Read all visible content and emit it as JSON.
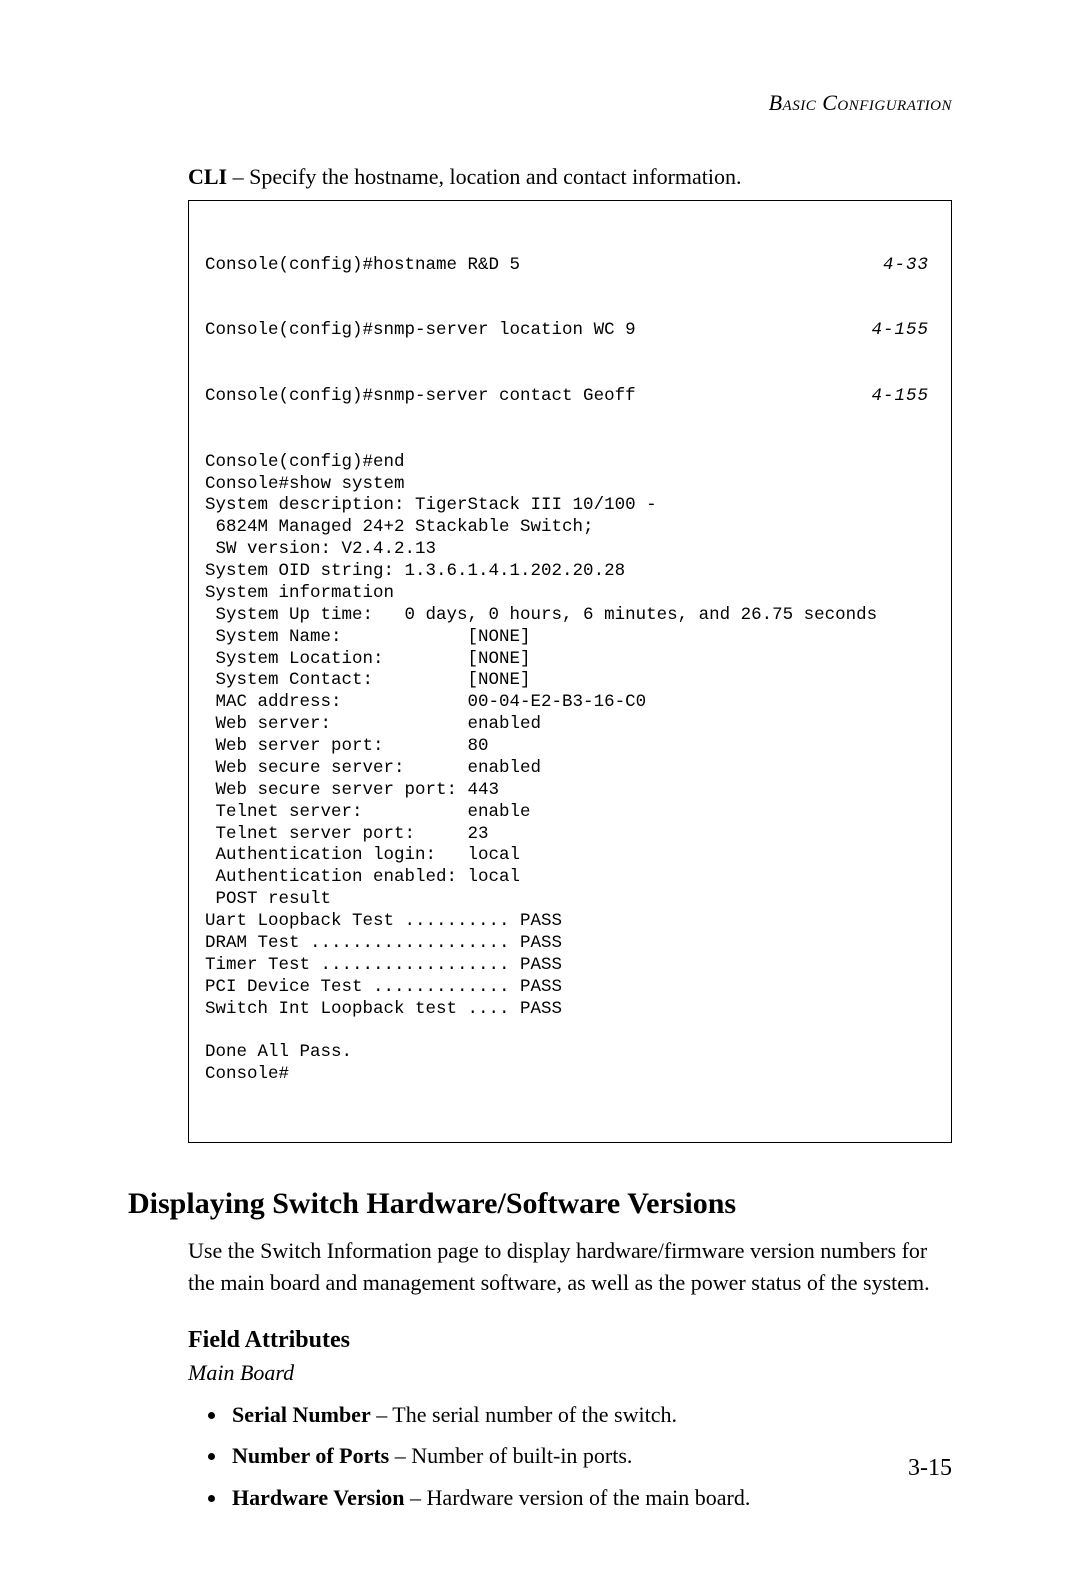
{
  "runningHead": "Basic Configuration",
  "intro": {
    "lead": "CLI",
    "rest": " – Specify the hostname, location and contact information."
  },
  "cli": {
    "refLines": [
      {
        "text": "Console(config)#hostname R&D 5",
        "ref": "4-33"
      },
      {
        "text": "Console(config)#snmp-server location WC 9",
        "ref": "4-155"
      },
      {
        "text": "Console(config)#snmp-server contact Geoff",
        "ref": "4-155"
      }
    ],
    "body": "Console(config)#end\nConsole#show system\nSystem description: TigerStack III 10/100 -\n 6824M Managed 24+2 Stackable Switch;\n SW version: V2.4.2.13\nSystem OID string: 1.3.6.1.4.1.202.20.28\nSystem information\n System Up time:   0 days, 0 hours, 6 minutes, and 26.75 seconds\n System Name:            [NONE]\n System Location:        [NONE]\n System Contact:         [NONE]\n MAC address:            00-04-E2-B3-16-C0\n Web server:             enabled\n Web server port:        80\n Web secure server:      enabled\n Web secure server port: 443\n Telnet server:          enable\n Telnet server port:     23\n Authentication login:   local\n Authentication enabled: local\n POST result\nUart Loopback Test .......... PASS\nDRAM Test ................... PASS\nTimer Test .................. PASS\nPCI Device Test ............. PASS\nSwitch Int Loopback test .... PASS\n\nDone All Pass.\nConsole#"
  },
  "sectionHeading": "Displaying Switch Hardware/Software Versions",
  "sectionBody": "Use the Switch Information page to display hardware/firmware version numbers for the main board and management software, as well as the power status of the system.",
  "subhead": "Field Attributes",
  "groupLabel": "Main Board",
  "attrs": [
    {
      "term": "Serial Number",
      "desc": " – The serial number of the switch."
    },
    {
      "term": "Number of Ports",
      "desc": " – Number of built-in ports."
    },
    {
      "term": "Hardware Version",
      "desc": " – Hardware version of the main board."
    }
  ],
  "pageNumber": "3-15"
}
